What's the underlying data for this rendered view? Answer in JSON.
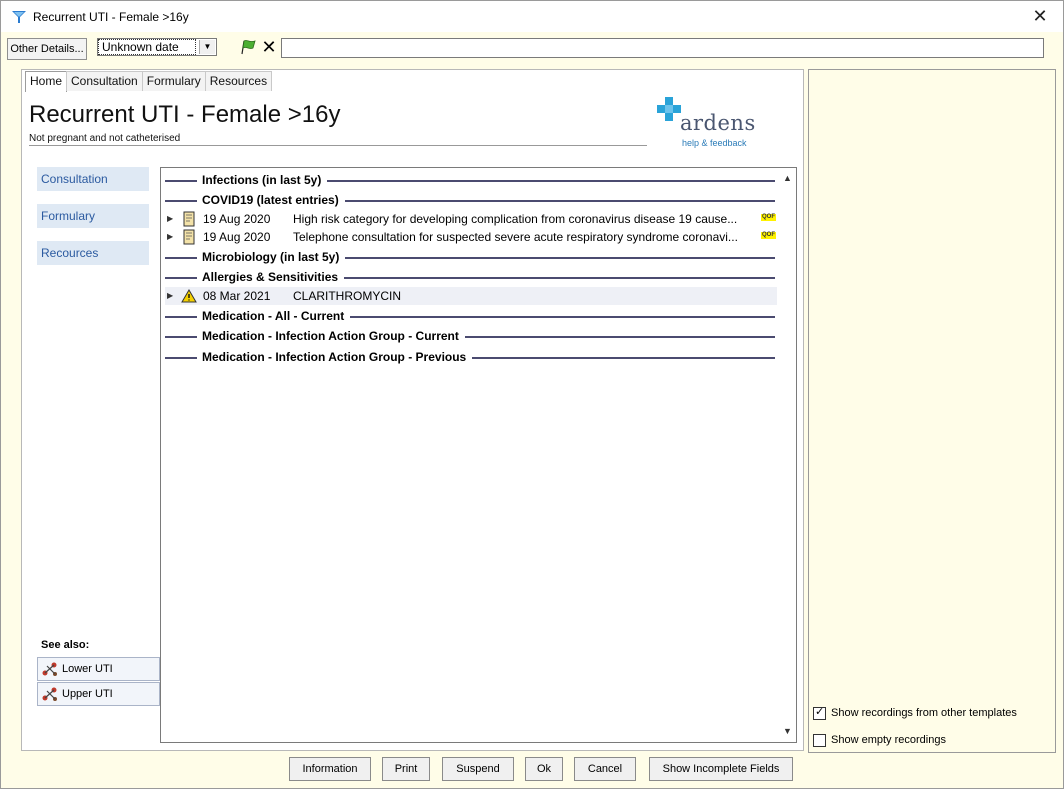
{
  "window": {
    "title": "Recurrent UTI - Female >16y",
    "close_glyph": "✕"
  },
  "toolbar": {
    "other_details_label": "Other Details...",
    "date_value": "Unknown date",
    "text_value": ""
  },
  "tabs": [
    {
      "label": "Home",
      "active": true
    },
    {
      "label": "Consultation",
      "active": false
    },
    {
      "label": "Formulary",
      "active": false
    },
    {
      "label": "Resources",
      "active": false
    }
  ],
  "page": {
    "title": "Recurrent UTI - Female >16y",
    "subtitle": "Not pregnant and not catheterised"
  },
  "logo": {
    "word": "ardens",
    "help_link": "help & feedback",
    "colors": {
      "cross": "#2aa3d8",
      "word": "#4a5670"
    }
  },
  "side_nav": [
    {
      "label": "Consultation"
    },
    {
      "label": "Formulary"
    },
    {
      "label": "Recources"
    }
  ],
  "see_also": {
    "label": "See also:",
    "items": [
      {
        "label": "Lower UTI"
      },
      {
        "label": "Upper UTI"
      }
    ]
  },
  "tree": {
    "sections": [
      {
        "label": "Infections (in last 5y)"
      },
      {
        "label": "COVID19 (latest entries)"
      },
      {
        "label": "Microbiology (in last 5y)"
      },
      {
        "label": "Allergies & Sensitivities"
      },
      {
        "label": "Medication - All - Current"
      },
      {
        "label": "Medication - Infection Action Group - Current"
      },
      {
        "label": "Medication - Infection Action Group - Previous"
      }
    ],
    "entries": [
      {
        "date": "19 Aug 2020",
        "text": "High risk category for developing complication from coronavirus disease 19 cause...",
        "badge": "QOF",
        "icon": "document-icon"
      },
      {
        "date": "19 Aug 2020",
        "text": "Telephone consultation for suspected severe acute respiratory syndrome coronavi...",
        "badge": "QOF",
        "icon": "document-icon"
      },
      {
        "date": "08 Mar 2021",
        "text": "CLARITHROMYCIN",
        "badge": "",
        "icon": "allergy-warning-icon"
      }
    ]
  },
  "right_panel": {
    "show_other_templates": {
      "label": "Show recordings from other templates",
      "checked": true
    },
    "show_empty": {
      "label": "Show empty recordings",
      "checked": false
    }
  },
  "footer": {
    "information": "Information",
    "print": "Print",
    "suspend": "Suspend",
    "ok": "Ok",
    "cancel": "Cancel",
    "show_incomplete": "Show Incomplete Fields"
  }
}
